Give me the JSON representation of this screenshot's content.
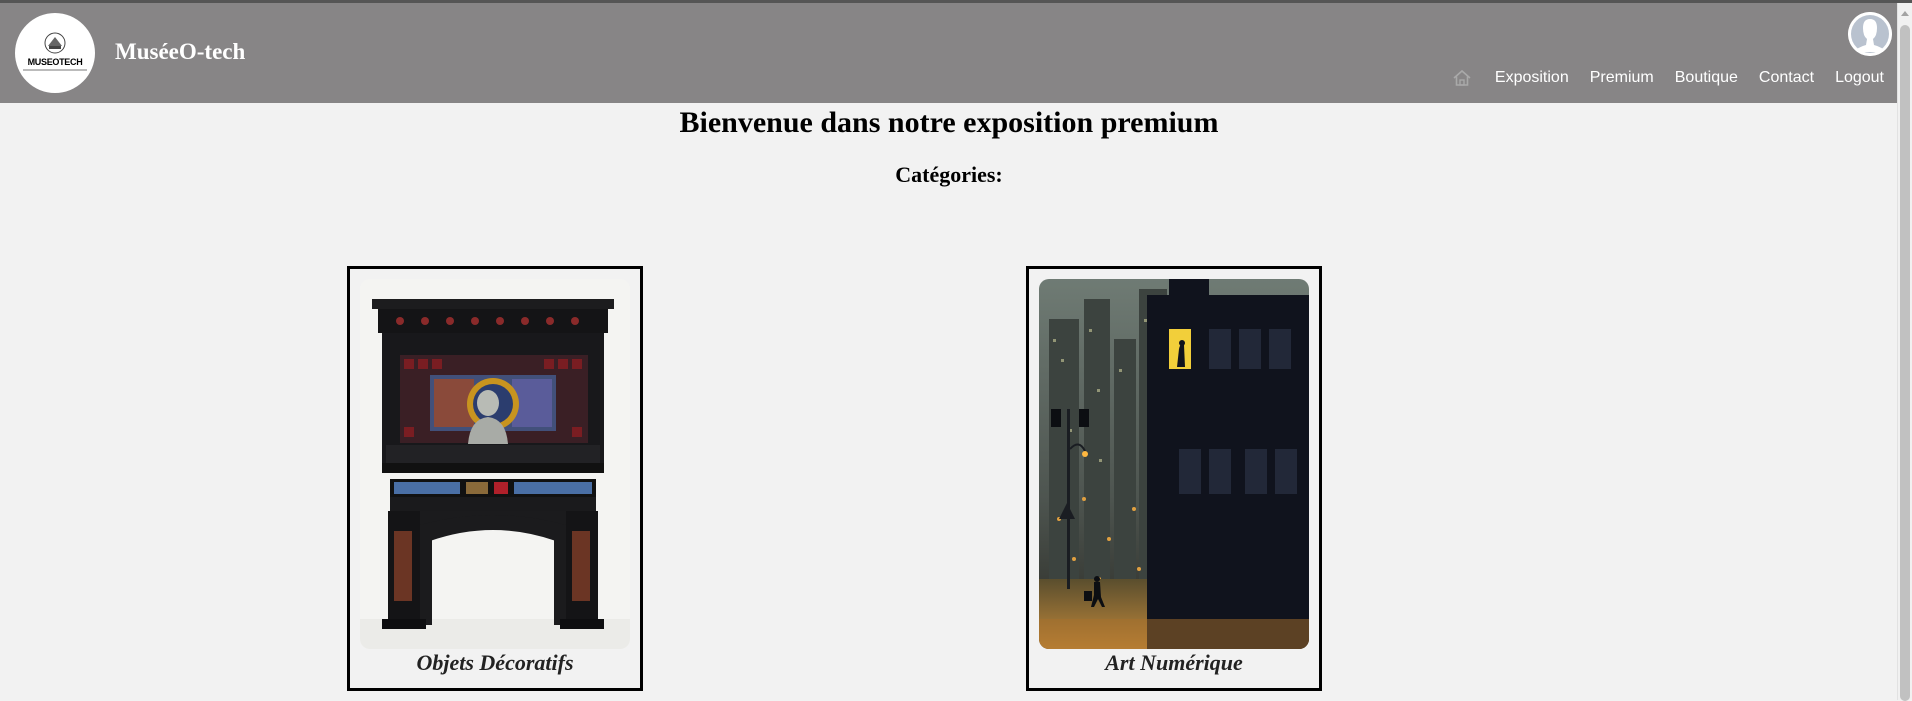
{
  "header": {
    "logo_text": "MUSEOTECH",
    "site_title": "MuséeO-tech"
  },
  "nav": {
    "items": [
      {
        "label": "Exposition"
      },
      {
        "label": "Premium"
      },
      {
        "label": "Boutique"
      },
      {
        "label": "Contact"
      },
      {
        "label": "Logout"
      }
    ],
    "home_icon": "home-icon",
    "avatar_icon": "user-avatar-icon"
  },
  "main": {
    "title": "Bienvenue dans notre exposition premium",
    "subtitle": "Catégories:",
    "categories": [
      {
        "label": "Objets Décoratifs",
        "image": "fireplace-mantel-image"
      },
      {
        "label": "Art Numérique",
        "image": "night-city-digital-art-image"
      }
    ]
  },
  "colors": {
    "header_bg": "#878586",
    "page_bg": "#f2f2f2",
    "text": "#000000"
  }
}
